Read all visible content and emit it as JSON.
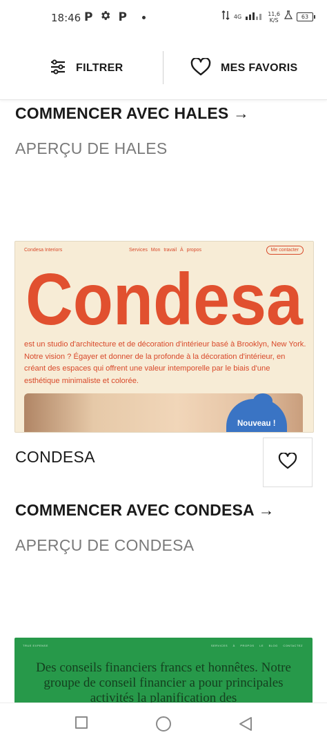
{
  "status_bar": {
    "time": "18:46",
    "left_icons": [
      "P",
      "settings-icon",
      "P"
    ],
    "network": "4G",
    "speed_value": "11,6",
    "speed_unit": "K/S",
    "battery": "63"
  },
  "filter_bar": {
    "filter_label": "FILTRER",
    "favorites_label": "MES FAVORIS"
  },
  "items": [
    {
      "start_link": "COMMENCER AVEC HALES →",
      "preview_link": "APERÇU DE HALES"
    },
    {
      "preview": {
        "brand": "Condesa Interiors",
        "nav_links": "Services  Mon travail  À propos",
        "cta": "Me contacter",
        "hero_word": "Condesa",
        "description": "est un studio d'architecture et de décoration d'intérieur basé à Brooklyn, New York. Notre vision ? Égayer et donner de la profonde à la décoration d'intérieur, en créant des espaces qui offrent une valeur intemporelle par le biais d'une esthétique minimaliste et colorée.",
        "badge": "Nouveau !"
      },
      "title": "CONDESA",
      "start_link": "COMMENCER AVEC CONDESA →",
      "preview_link": "APERÇU DE CONDESA"
    },
    {
      "preview": {
        "brand": "TRUE EXPENSE",
        "nav_links": "SERVICES  À PROPOS  LE BLOG  CONTACTEZ",
        "text": "Des conseils financiers francs et honnêtes. Notre groupe de conseil financier a pour principales activités la planification des"
      }
    }
  ],
  "colors": {
    "condesa_bg": "#f7ecd6",
    "condesa_accent": "#d8492a",
    "badge_blue": "#3a74c4",
    "green_card": "#27994a"
  }
}
